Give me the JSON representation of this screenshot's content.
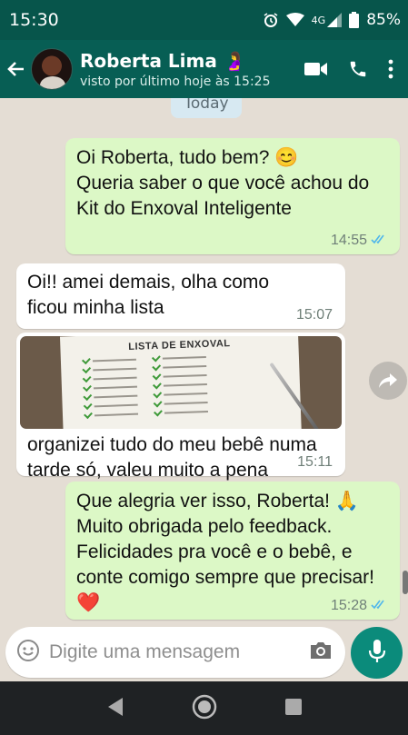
{
  "status_bar": {
    "time": "15:30",
    "network": "4G",
    "battery": "85%",
    "icons": [
      "alarm-icon",
      "wifi-icon",
      "signal-icon",
      "battery-icon"
    ]
  },
  "header": {
    "contact_name": "Roberta Lima 🤰",
    "last_seen": "visto por último hoje às 15:25",
    "icons": [
      "back-arrow-icon",
      "video-call-icon",
      "phone-icon",
      "more-options-icon"
    ]
  },
  "chat": {
    "date_label": "Today",
    "messages": [
      {
        "direction": "outgoing",
        "text": "Oi Roberta, tudo bem? 😊\nQueria saber o que você achou do Kit do Enxoval Inteligente",
        "time": "14:55",
        "status": "read"
      },
      {
        "direction": "incoming",
        "text": "Oi!! amei demais, olha como ficou minha lista",
        "time": "15:07"
      },
      {
        "direction": "incoming",
        "type": "image",
        "image_title": "LISTA DE ENXOVAL",
        "caption": "organizei tudo do meu bebê numa tarde só, valeu muito a pena",
        "time": "15:11"
      },
      {
        "direction": "outgoing",
        "text": "Que alegria ver isso, Roberta! 🙏\nMuito obrigada pelo feedback.\nFelicidades pra você e o bebê, e conte comigo sempre que precisar! ❤️",
        "time": "15:28",
        "status": "read"
      }
    ]
  },
  "composer": {
    "placeholder": "Digite uma mensagem",
    "icons": [
      "emoji-icon",
      "camera-icon",
      "microphone-icon"
    ]
  },
  "nav": {
    "icons": [
      "back-nav-icon",
      "home-nav-icon",
      "recents-nav-icon"
    ]
  },
  "colors": {
    "header": "#075e54",
    "outgoing_bubble": "#dcf8c6",
    "incoming_bubble": "#ffffff",
    "read_ticks": "#4fb6ec",
    "mic_button": "#0b8b7b",
    "chat_background": "#e4ddd4"
  }
}
